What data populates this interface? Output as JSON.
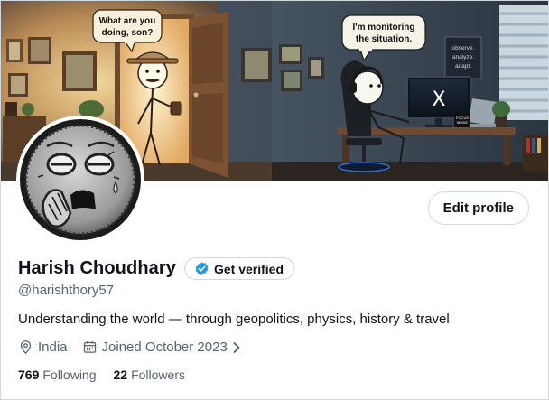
{
  "banner": {
    "bubble_left": "What are you\ndoing, son?",
    "bubble_left_lines": [
      "What are you",
      "doing, son?"
    ],
    "bubble_right_lines": [
      "I'm monitoring",
      "the situation."
    ],
    "wall_note_lines": [
      "observe.",
      "analyze.",
      "adapt."
    ],
    "monitor_logo": "X",
    "mug_text_lines": [
      "FOCUS",
      "MODE"
    ]
  },
  "profile": {
    "display_name": "Harish Choudhary",
    "verify_label": "Get verified",
    "handle": "@harishthory57",
    "bio": "Understanding the world — through geopolitics, physics, history & travel",
    "location": "India",
    "joined": "Joined October 2023",
    "following_count": "769",
    "following_label": "Following",
    "followers_count": "22",
    "followers_label": "Followers"
  },
  "actions": {
    "edit_profile_label": "Edit profile"
  },
  "colors": {
    "accent_blue": "#1d9bf0",
    "text_primary": "#0f1419",
    "text_secondary": "#536471",
    "border": "#cfd9de"
  },
  "icons": {
    "verify": "verified-badge-icon",
    "location": "location-pin-icon",
    "calendar": "calendar-icon",
    "chevron": "chevron-right-icon"
  }
}
